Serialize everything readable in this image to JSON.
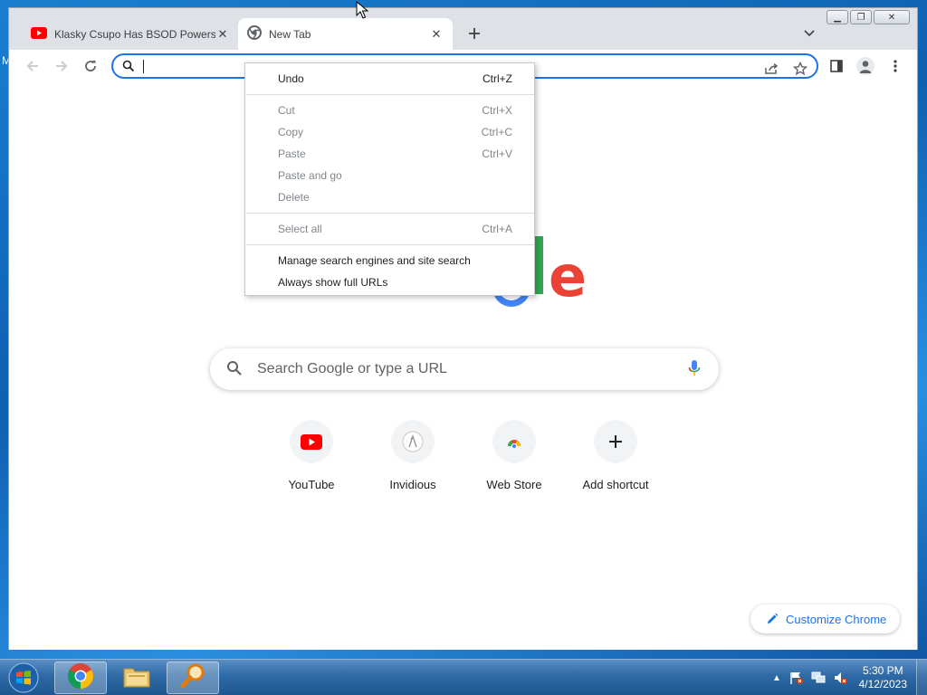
{
  "desktop": {
    "edge_glyph": "M"
  },
  "tabs": [
    {
      "title": "Klasky Csupo Has BSOD Powers",
      "icon": "youtube-icon",
      "active": false
    },
    {
      "title": "New Tab",
      "icon": "chrome-icon",
      "active": true
    }
  ],
  "omnibox": {
    "value": ""
  },
  "new_tab_page": {
    "logo_visible_letters": "le",
    "search_placeholder": "Search Google or type a URL",
    "shortcuts": [
      {
        "label": "YouTube",
        "icon": "youtube-icon"
      },
      {
        "label": "Invidious",
        "icon": "invidious-icon"
      },
      {
        "label": "Web Store",
        "icon": "web-store-icon"
      },
      {
        "label": "Add shortcut",
        "icon": "plus-icon"
      }
    ],
    "customize_label": "Customize Chrome"
  },
  "context_menu": {
    "items": [
      {
        "label": "Undo",
        "shortcut": "Ctrl+Z",
        "enabled": true
      },
      {
        "label": "Cut",
        "shortcut": "Ctrl+X",
        "enabled": false
      },
      {
        "label": "Copy",
        "shortcut": "Ctrl+C",
        "enabled": false
      },
      {
        "label": "Paste",
        "shortcut": "Ctrl+V",
        "enabled": false
      },
      {
        "label": "Paste and go",
        "shortcut": "",
        "enabled": false
      },
      {
        "label": "Delete",
        "shortcut": "",
        "enabled": false
      },
      {
        "label": "Select all",
        "shortcut": "Ctrl+A",
        "enabled": false
      },
      {
        "label": "Manage search engines and site search",
        "shortcut": "",
        "enabled": true
      },
      {
        "label": "Always show full URLs",
        "shortcut": "",
        "enabled": true
      }
    ]
  },
  "taskbar": {
    "apps": [
      {
        "name": "chrome-icon",
        "active": true
      },
      {
        "name": "file-explorer-icon",
        "active": false
      },
      {
        "name": "magnifier-icon",
        "active": true
      }
    ],
    "time": "5:30 PM",
    "date": "4/12/2023"
  },
  "colors": {
    "accent": "#1a73e8",
    "google_red": "#ea4335",
    "google_green": "#34a853",
    "google_blue": "#4285f4"
  }
}
